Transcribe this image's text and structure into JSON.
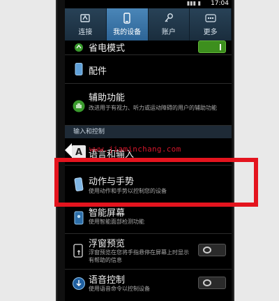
{
  "status_bar": {
    "time": "17:04",
    "signal": "▮▮▮ ▮"
  },
  "tabs": [
    {
      "label": "连接",
      "icon": "connection-icon",
      "active": false
    },
    {
      "label": "我的设备",
      "icon": "device-icon",
      "active": true
    },
    {
      "label": "账户",
      "icon": "account-key-icon",
      "active": false
    },
    {
      "label": "更多",
      "icon": "more-dots-icon",
      "active": false
    }
  ],
  "rows": {
    "power_saving": {
      "title": "省电模式",
      "icon": "recycle-icon",
      "toggle": "on"
    },
    "accessories": {
      "title": "配件",
      "icon": "phone-accessory-icon"
    },
    "accessibility": {
      "title": "辅助功能",
      "subtitle": "改进用于有视力、听力或运动障碍的用户的辅助功能",
      "icon": "hand-icon"
    },
    "section_header": "输入和控制",
    "language_input": {
      "title": "语言和输入",
      "icon": "keyboard-a-icon"
    },
    "motion": {
      "title": "动作与手势",
      "subtitle": "使用动作和手势以控制您的设备",
      "icon": "motion-phone-icon"
    },
    "smart_screen": {
      "title": "智能屏幕",
      "subtitle": "使用智能面部检测功能",
      "icon": "smart-screen-icon"
    },
    "air_view": {
      "title": "浮窗预览",
      "subtitle": "浮窗预览在您将手指悬停在屏幕上时显示有帮助的信息",
      "icon": "air-view-icon",
      "toggle": "off"
    },
    "voice_control": {
      "title": "语音控制",
      "subtitle": "使用语音命令以控制设备",
      "icon": "voice-control-icon",
      "toggle": "off"
    }
  },
  "watermark": "www.jiaminchang.com",
  "colors": {
    "highlight": "#e4141e",
    "tab_active": "#3d79ad",
    "toggle_on": "#3d8f1e"
  }
}
